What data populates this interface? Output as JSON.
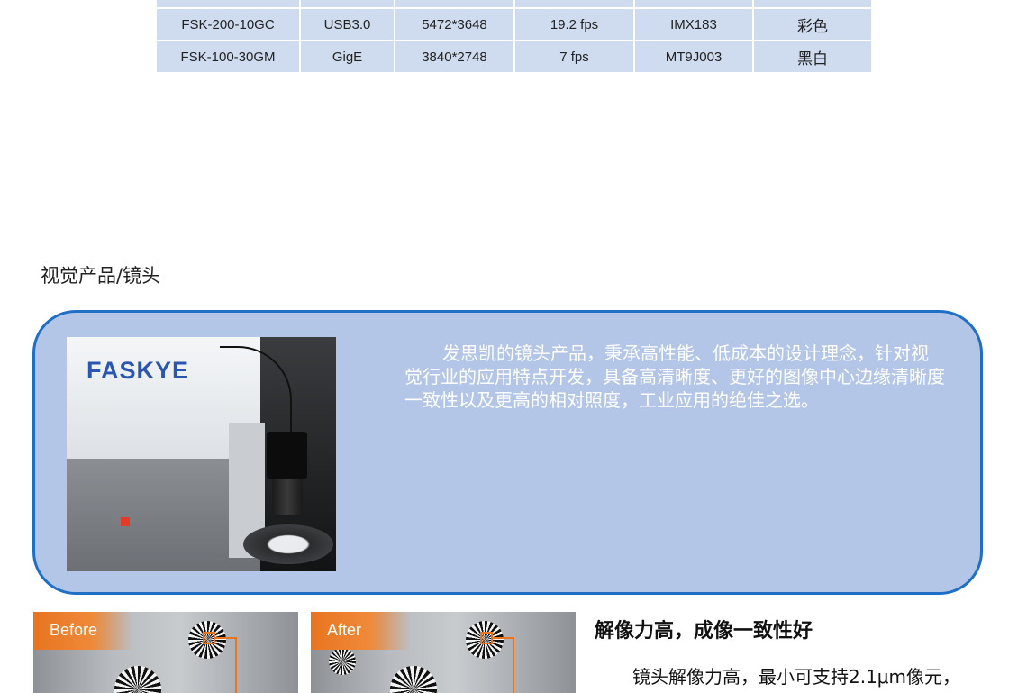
{
  "spec_table": {
    "rows": [
      {
        "model": "FSK-200-10GC",
        "interface": "USB3.0",
        "resolution": "5472*3648",
        "frame_rate": "19.2 fps",
        "sensor": "IMX183",
        "color": "彩色"
      },
      {
        "model": "FSK-100-30GM",
        "interface": "GigE",
        "resolution": "3840*2748",
        "frame_rate": "7 fps",
        "sensor": "MT9J003",
        "color": "黑白"
      }
    ]
  },
  "section_title": "视觉产品/镜头",
  "lens_panel": {
    "logo": "FASKYE",
    "description": "发思凯的镜头产品，秉承高性能、低成本的设计理念，针对视觉行业的应用特点开发，具备高清晰度、更好的图像中心边缘清晰度一致性以及更高的相对照度，工业应用的绝佳之选。"
  },
  "comparison": {
    "before_label": "Before",
    "after_label": "After"
  },
  "feature": {
    "title": "解像力高，成像一致性好",
    "text": "镜头解像力高，最小可支持2.1μm像元，"
  },
  "colors": {
    "panel_bg": "#b3c6e8",
    "panel_border": "#1f6fc7",
    "table_cell": "#cfdcef",
    "accent_orange": "#e8741f"
  }
}
